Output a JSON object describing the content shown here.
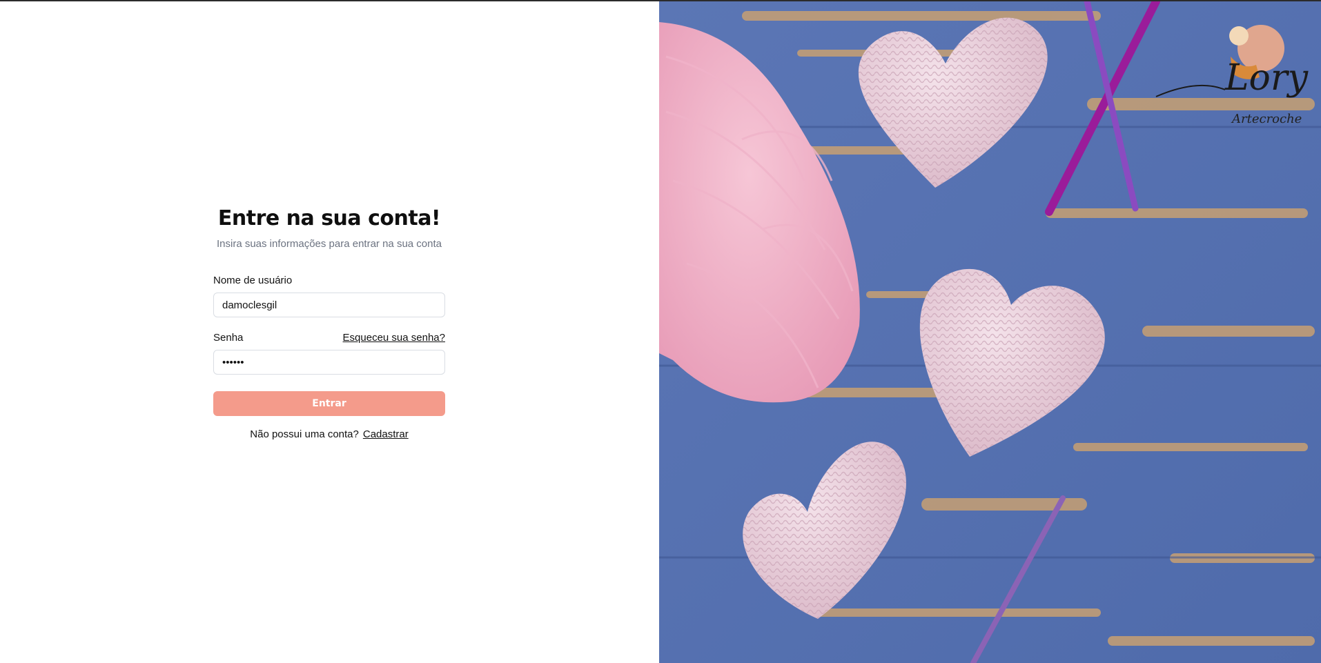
{
  "login": {
    "title": "Entre na sua conta!",
    "subtitle": "Insira suas informações para entrar na sua conta",
    "username": {
      "label": "Nome de usuário",
      "value": "damoclesgil"
    },
    "password": {
      "label": "Senha",
      "value": "damocl",
      "forgot_link": "Esqueceu sua senha?"
    },
    "submit_label": "Entrar",
    "signup_prompt": "Não possui uma conta?",
    "signup_link": "Cadastrar"
  },
  "brand": {
    "logo_name": "Lory",
    "logo_tagline": "Artecroche",
    "accent_color": "#f49b8b"
  },
  "hero_image": {
    "icons": [
      "yarn-ball-icon",
      "crochet-heart-icon",
      "crochet-hook-icon"
    ]
  }
}
